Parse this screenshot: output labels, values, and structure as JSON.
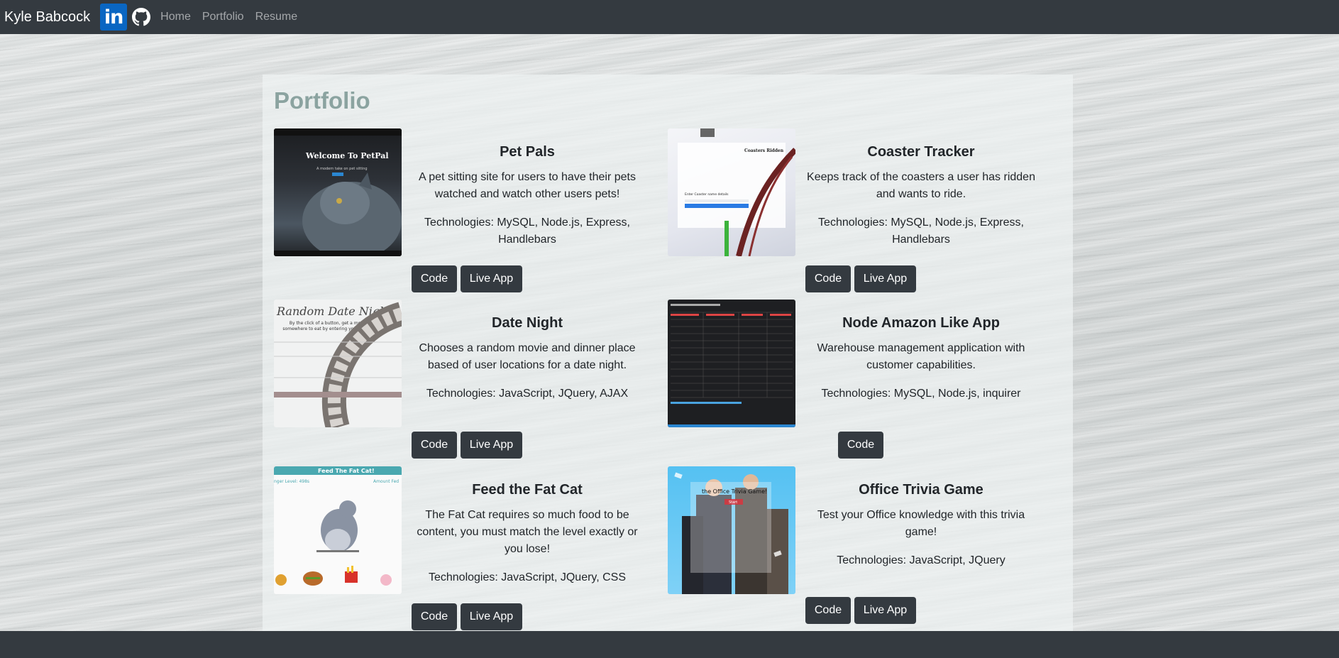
{
  "navbar": {
    "brand": "Kyle Babcock",
    "linkedin_icon": "linkedin-icon",
    "linkedin_text": "in",
    "github_icon": "github-icon",
    "links": [
      "Home",
      "Portfolio",
      "Resume"
    ]
  },
  "page": {
    "title": "Portfolio"
  },
  "projects": [
    {
      "title": "Pet Pals",
      "description": "A pet sitting site for users to have their pets watched and watch other users pets!",
      "technologies": "Technologies: MySQL, Node.js, Express, Handlebars",
      "code_label": "Code",
      "live_label": "Live App",
      "thumb_text": "Welcome To PetPal",
      "thumb_sub": "A modern take on pet sitting"
    },
    {
      "title": "Coaster Tracker",
      "description": "Keeps track of the coasters a user has ridden and wants to ride.",
      "technologies": "Technologies: MySQL, Node.js, Express, Handlebars",
      "code_label": "Code",
      "live_label": "Live App",
      "thumb_text": "Coasters Ridden",
      "thumb_sub": "Enter Coaster name details"
    },
    {
      "title": "Date Night",
      "description": "Chooses a random movie and dinner place based of user locations for a date night.",
      "technologies": "Technologies: JavaScript, JQuery, AJAX",
      "code_label": "Code",
      "live_label": "Live App",
      "thumb_text": "Random Date Night",
      "thumb_sub": "By the click of a button, get a movie to see & somewhere to eat by entering your zip code below!"
    },
    {
      "title": "Node Amazon Like App",
      "description": "Warehouse management application with customer capabilities.",
      "technologies": "Technologies: MySQL, Node.js, inquirer",
      "code_label": "Code"
    },
    {
      "title": "Feed the Fat Cat",
      "description": "The Fat Cat requires so much food to be content, you must match the level exactly or you lose!",
      "technologies": "Technologies: JavaScript, JQuery, CSS",
      "code_label": "Code",
      "live_label": "Live App",
      "thumb_text": "Feed The Fat Cat!",
      "thumb_left": "nger Level: 498s",
      "thumb_right": "Amount Fed"
    },
    {
      "title": "Office Trivia Game",
      "description": "Test your Office knowledge with this trivia game!",
      "technologies": "Technologies: JavaScript, JQuery",
      "code_label": "Code",
      "live_label": "Live App",
      "thumb_text": "the Office Trivia Game!",
      "thumb_sub": "Start"
    }
  ]
}
